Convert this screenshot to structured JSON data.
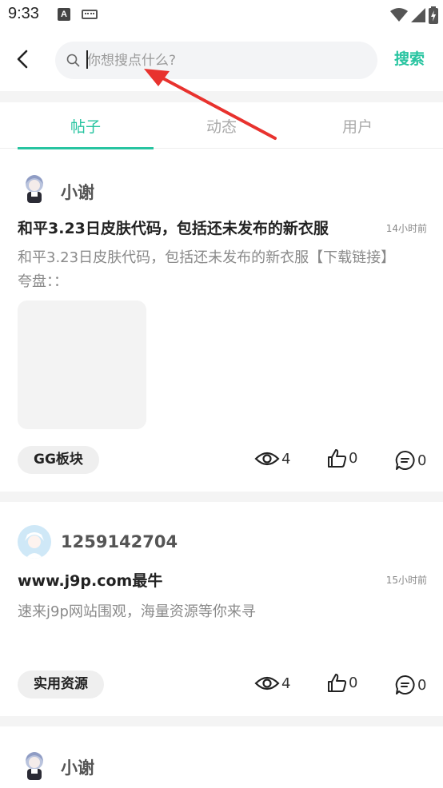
{
  "status_bar": {
    "time": "9:33",
    "icons": [
      "notification-a-icon",
      "keyboard-icon",
      "wifi-icon",
      "signal-icon",
      "battery-icon"
    ]
  },
  "header": {
    "back_icon": "chevron-left-icon",
    "search_placeholder": "你想搜点什么?",
    "search_value": "",
    "search_button": "搜索"
  },
  "tabs": [
    {
      "label": "帖子",
      "active": true
    },
    {
      "label": "动态",
      "active": false
    },
    {
      "label": "用户",
      "active": false
    }
  ],
  "posts": [
    {
      "username": "小谢",
      "title": "和平3.23日皮肤代码，包括还未发布的新衣服",
      "time": "14小时前",
      "body": "和平3.23日皮肤代码，包括还未发布的新衣服【下载链接】夸盘：：",
      "has_image": true,
      "tag": "GG板块",
      "views": "4",
      "likes": "0",
      "comments": "0"
    },
    {
      "username": "1259142704",
      "title": "www.j9p.com最牛",
      "time": "15小时前",
      "body": "速来j9p网站围观，海量资源等你来寻",
      "has_image": false,
      "tag": "实用资源",
      "views": "4",
      "likes": "0",
      "comments": "0"
    },
    {
      "username": "小谢"
    }
  ],
  "colors": {
    "accent": "#27c4a0",
    "annotation_arrow": "#e8322e",
    "separator": "#f4f4f4"
  }
}
